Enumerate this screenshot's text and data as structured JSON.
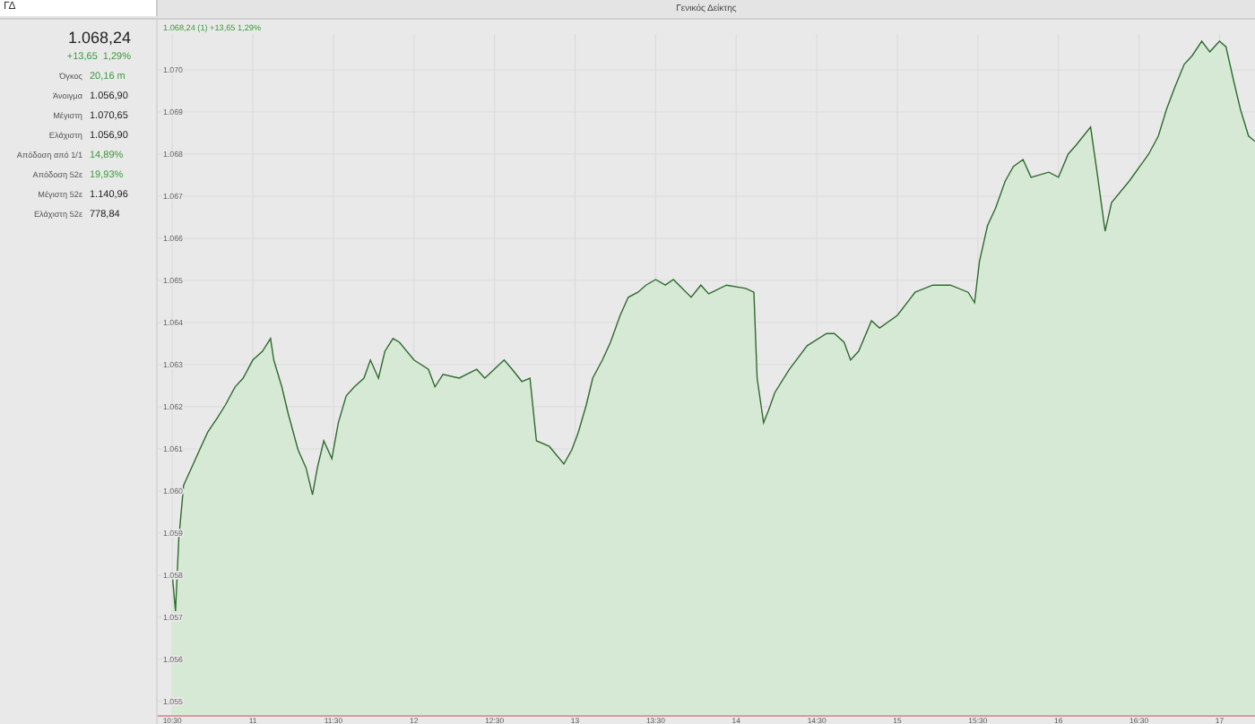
{
  "tab": {
    "label": "ΓΔ",
    "selected": true
  },
  "title": "Γενικός Δείκτης",
  "quote": {
    "price": "1.068,24",
    "change": "+13,65",
    "change_pct": "1,29%"
  },
  "stats": [
    {
      "label": "Όγκος",
      "value": "20,16 m",
      "kind": "positive"
    },
    {
      "label": "Άνοιγμα",
      "value": "1.056,90",
      "kind": "plain"
    },
    {
      "label": "Μέγιστη",
      "value": "1.070,65",
      "kind": "plain"
    },
    {
      "label": "Ελάχιστη",
      "value": "1.056,90",
      "kind": "plain"
    },
    {
      "label": "Απόδοση από 1/1",
      "value": "14,89%",
      "kind": "positive"
    },
    {
      "label": "Απόδοση 52ε",
      "value": "19,93%",
      "kind": "positive"
    },
    {
      "label": "Μέγιστη 52ε",
      "value": "1.140,96",
      "kind": "plain"
    },
    {
      "label": "Ελάχιστη 52ε",
      "value": "778,84",
      "kind": "plain"
    }
  ],
  "chart": {
    "legend": "1.068,24 (1) +13,65 1,29%",
    "chart_data": {
      "type": "area",
      "xlim": [
        10.41,
        17.22
      ],
      "ylim": [
        1054.68,
        1070.85
      ],
      "xticks": [
        {
          "value": 10.5,
          "label": "10:30"
        },
        {
          "value": 11,
          "label": "11"
        },
        {
          "value": 11.5,
          "label": "11:30"
        },
        {
          "value": 12,
          "label": "12"
        },
        {
          "value": 12.5,
          "label": "12:30"
        },
        {
          "value": 13,
          "label": "13"
        },
        {
          "value": 13.5,
          "label": "13:30"
        },
        {
          "value": 14,
          "label": "14"
        },
        {
          "value": 14.5,
          "label": "14:30"
        },
        {
          "value": 15,
          "label": "15"
        },
        {
          "value": 15.5,
          "label": "15:30"
        },
        {
          "value": 16,
          "label": "16"
        },
        {
          "value": 16.5,
          "label": "16:30"
        },
        {
          "value": 17,
          "label": "17"
        }
      ],
      "yticks": [
        {
          "value": 1055,
          "label": "1.055"
        },
        {
          "value": 1056,
          "label": "1.056"
        },
        {
          "value": 1057,
          "label": "1.057"
        },
        {
          "value": 1058,
          "label": "1.058"
        },
        {
          "value": 1059,
          "label": "1.059"
        },
        {
          "value": 1060,
          "label": "1.060"
        },
        {
          "value": 1061,
          "label": "1.061"
        },
        {
          "value": 1062,
          "label": "1.062"
        },
        {
          "value": 1063,
          "label": "1.063"
        },
        {
          "value": 1064,
          "label": "1.064"
        },
        {
          "value": 1065,
          "label": "1.065"
        },
        {
          "value": 1066,
          "label": "1.066"
        },
        {
          "value": 1067,
          "label": "1.067"
        },
        {
          "value": 1068,
          "label": "1.068"
        },
        {
          "value": 1069,
          "label": "1.069"
        },
        {
          "value": 1070,
          "label": "1.070"
        }
      ],
      "x": [
        10.5,
        10.52,
        10.54,
        10.57,
        10.61,
        10.67,
        10.72,
        10.78,
        10.83,
        10.89,
        10.94,
        11.0,
        11.06,
        11.11,
        11.13,
        11.18,
        11.22,
        11.28,
        11.33,
        11.37,
        11.4,
        11.44,
        11.49,
        11.53,
        11.58,
        11.63,
        11.69,
        11.73,
        11.78,
        11.82,
        11.87,
        11.91,
        12.0,
        12.09,
        12.13,
        12.18,
        12.28,
        12.39,
        12.44,
        12.56,
        12.61,
        12.67,
        12.72,
        12.76,
        12.84,
        12.93,
        12.98,
        13.02,
        13.07,
        13.11,
        13.17,
        13.22,
        13.28,
        13.33,
        13.39,
        13.44,
        13.5,
        13.56,
        13.61,
        13.72,
        13.78,
        13.83,
        13.94,
        14.06,
        14.11,
        14.13,
        14.17,
        14.2,
        14.24,
        14.33,
        14.44,
        14.56,
        14.61,
        14.67,
        14.71,
        14.76,
        14.84,
        14.89,
        15.0,
        15.11,
        15.22,
        15.33,
        15.44,
        15.48,
        15.51,
        15.56,
        15.61,
        15.67,
        15.72,
        15.78,
        15.83,
        15.94,
        16.0,
        16.06,
        16.11,
        16.2,
        16.24,
        16.29,
        16.33,
        16.44,
        16.56,
        16.62,
        16.67,
        16.72,
        16.78,
        16.83,
        16.89,
        16.94,
        17.0,
        17.04,
        17.09,
        17.13,
        17.18,
        17.22
      ],
      "grid": true,
      "series": [
        {
          "color": "#2f6b2f",
          "values": [
            1058.0,
            1057.15,
            1058.85,
            1060.13,
            1060.47,
            1060.98,
            1061.4,
            1061.74,
            1062.04,
            1062.47,
            1062.68,
            1063.11,
            1063.32,
            1063.62,
            1063.11,
            1062.47,
            1061.83,
            1060.98,
            1060.55,
            1059.91,
            1060.55,
            1061.19,
            1060.77,
            1061.62,
            1062.26,
            1062.47,
            1062.68,
            1063.11,
            1062.68,
            1063.32,
            1063.62,
            1063.53,
            1063.11,
            1062.89,
            1062.47,
            1062.77,
            1062.68,
            1062.89,
            1062.68,
            1063.11,
            1062.89,
            1062.6,
            1062.68,
            1061.19,
            1061.06,
            1060.64,
            1060.98,
            1061.4,
            1062.04,
            1062.68,
            1063.11,
            1063.53,
            1064.17,
            1064.6,
            1064.72,
            1064.89,
            1065.02,
            1064.89,
            1065.02,
            1064.6,
            1064.89,
            1064.68,
            1064.89,
            1064.81,
            1064.72,
            1062.68,
            1061.62,
            1061.91,
            1062.34,
            1062.89,
            1063.45,
            1063.74,
            1063.74,
            1063.53,
            1063.11,
            1063.32,
            1064.04,
            1063.87,
            1064.17,
            1064.72,
            1064.89,
            1064.89,
            1064.72,
            1064.47,
            1065.45,
            1066.3,
            1066.72,
            1067.36,
            1067.7,
            1067.87,
            1067.45,
            1067.57,
            1067.45,
            1068.0,
            1068.21,
            1068.64,
            1067.57,
            1066.17,
            1066.85,
            1067.36,
            1068.0,
            1068.43,
            1069.06,
            1069.57,
            1070.13,
            1070.34,
            1070.68,
            1070.43,
            1070.68,
            1070.55,
            1069.7,
            1069.06,
            1068.43,
            1068.3
          ]
        }
      ]
    }
  }
}
